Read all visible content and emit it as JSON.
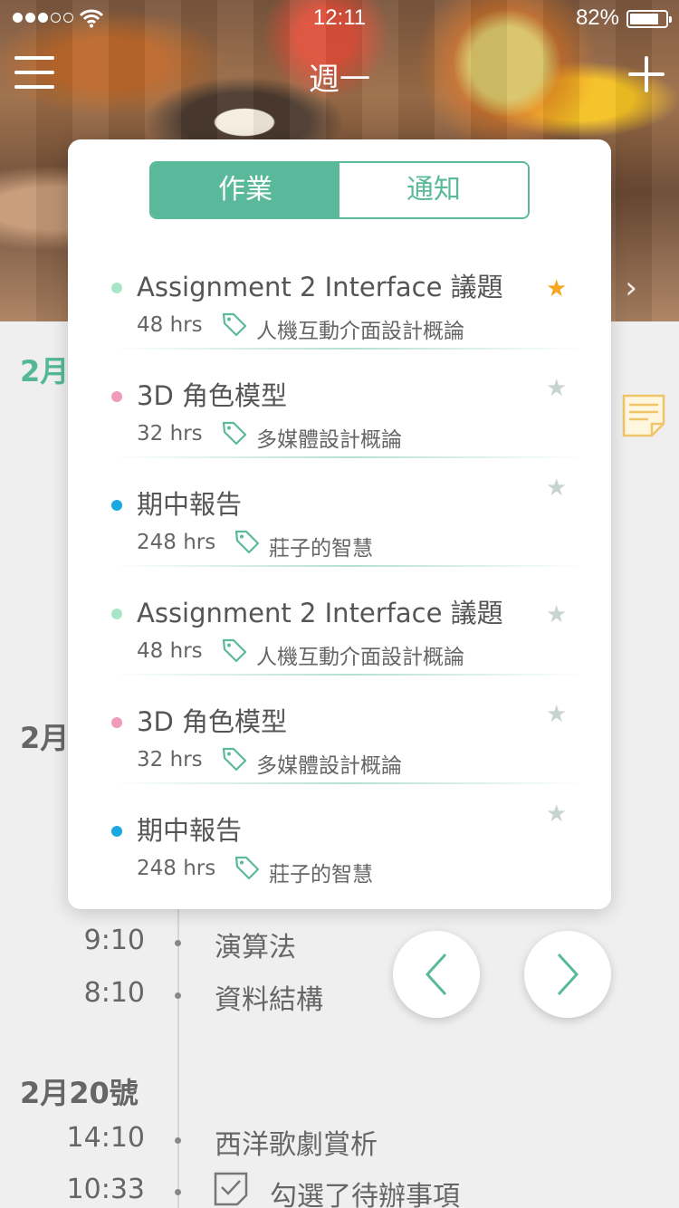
{
  "status_bar": {
    "time": "12:11",
    "battery": "82%",
    "battery_level": 0.82
  },
  "nav": {
    "title": "週一"
  },
  "background": {
    "dates": {
      "first": "2月",
      "second": "2月",
      "third": "2月20號"
    },
    "events": [
      {
        "time": "9:10",
        "name": "演算法"
      },
      {
        "time": "8:10",
        "name": "資料結構"
      },
      {
        "time": "14:10",
        "name": "西洋歌劇賞析"
      },
      {
        "time": "10:33",
        "name": "勾選了待辦事項"
      }
    ]
  },
  "popup": {
    "tabs": {
      "homework": "作業",
      "notifications": "通知"
    },
    "items": [
      {
        "title": "Assignment 2 Interface 議題",
        "hours": "48 hrs",
        "course": "人機互動介面設計概論",
        "dot_color": "#a8e6c8",
        "starred": true
      },
      {
        "title": "3D 角色模型",
        "hours": "32 hrs",
        "course": "多媒體設計概論",
        "dot_color": "#ef9bbb",
        "starred": false
      },
      {
        "title": "期中報告",
        "hours": "248 hrs",
        "course": "莊子的智慧",
        "dot_color": "#1aa8e0",
        "starred": false
      },
      {
        "title": "Assignment 2 Interface 議題",
        "hours": "48 hrs",
        "course": "人機互動介面設計概論",
        "dot_color": "#a8e6c8",
        "starred": false
      },
      {
        "title": "3D 角色模型",
        "hours": "32 hrs",
        "course": "多媒體設計概論",
        "dot_color": "#ef9bbb",
        "starred": false
      },
      {
        "title": "期中報告",
        "hours": "248 hrs",
        "course": "莊子的智慧",
        "dot_color": "#1aa8e0",
        "starred": false
      }
    ]
  },
  "colors": {
    "accent": "#5ab99a",
    "star_active": "#f5a623",
    "star_inactive": "#c7d4d0"
  }
}
